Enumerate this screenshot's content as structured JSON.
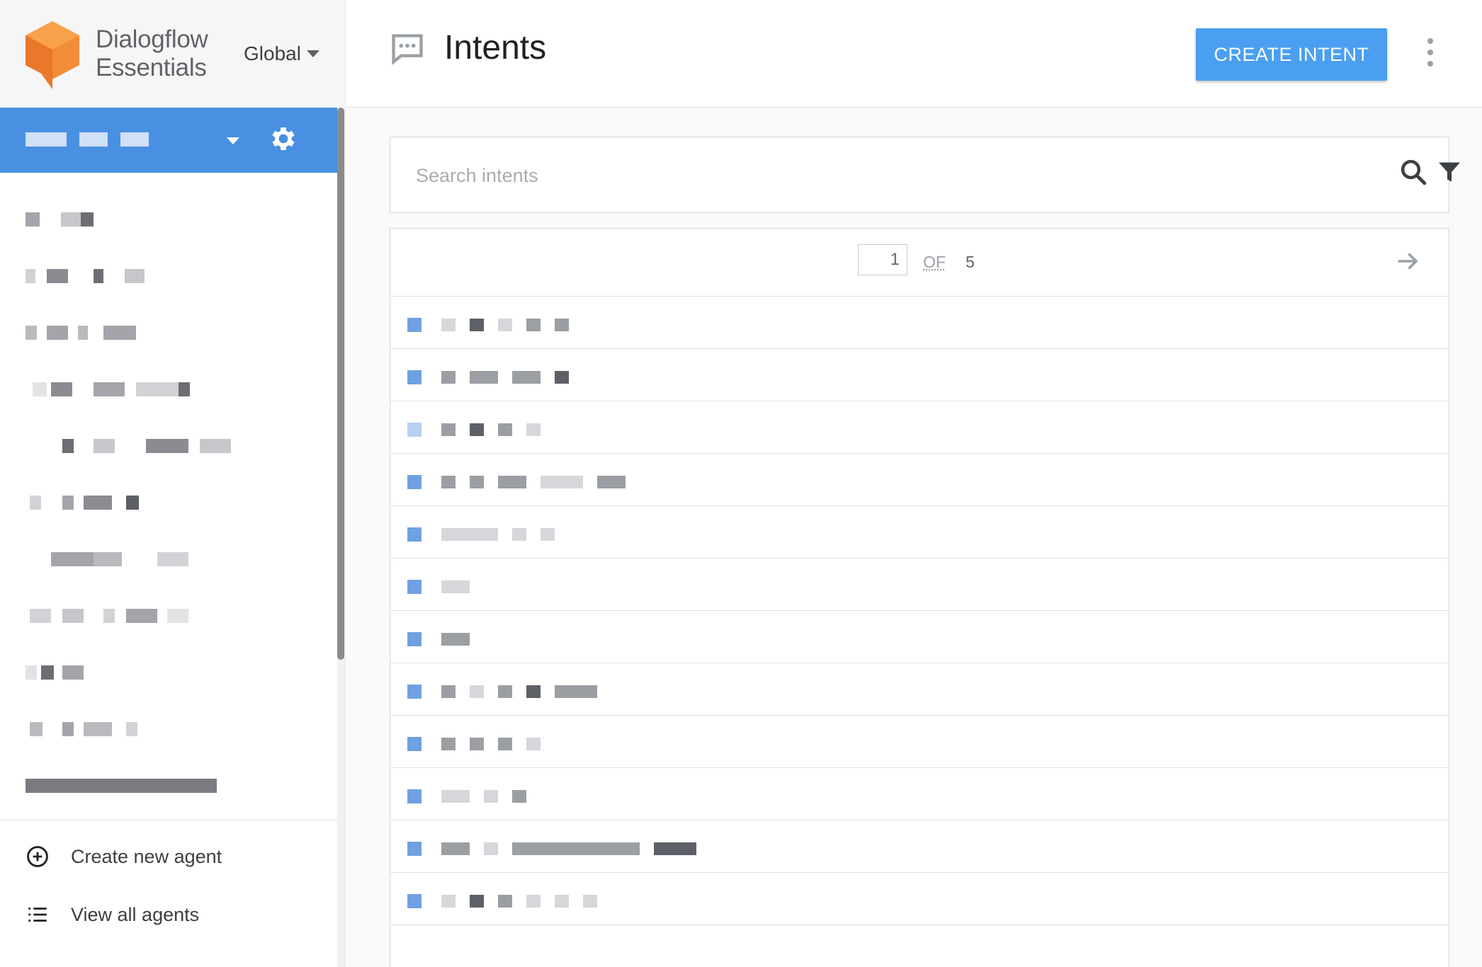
{
  "sidebar": {
    "brand_line1": "Dialogflow",
    "brand_line2": "Essentials",
    "region": "Global",
    "agent_name": "",
    "agent_item_count": 11,
    "create_agent_label": "Create new agent",
    "view_all_label": "View all agents"
  },
  "main": {
    "title": "Intents",
    "create_button_label": "CREATE INTENT",
    "search_placeholder": "Search intents",
    "pager": {
      "current": "1",
      "of_label": "OF",
      "total": "5"
    },
    "intent_row_count": 12
  },
  "colors": {
    "accent": "#4a90e2",
    "button": "#4a9ff0",
    "logo_orange": "#ef8a33"
  }
}
